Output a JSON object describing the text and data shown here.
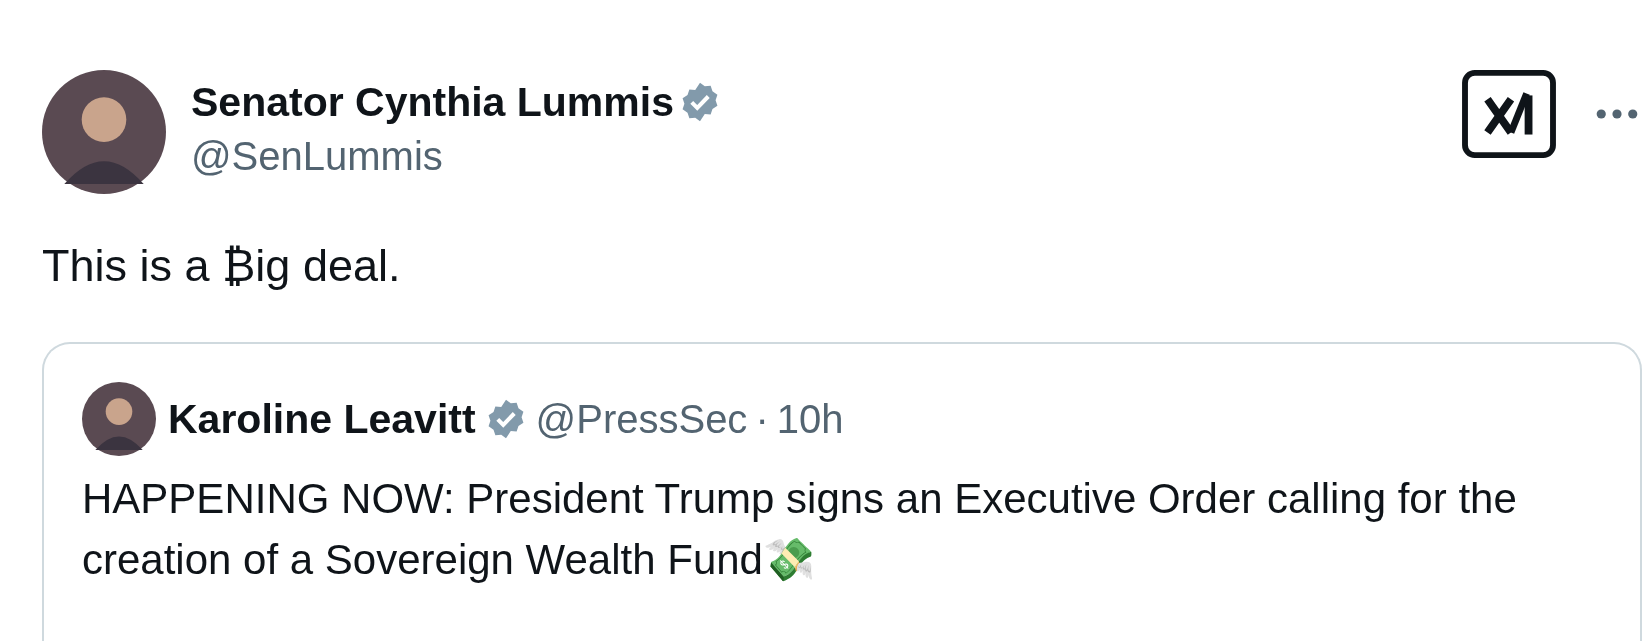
{
  "post": {
    "author": {
      "name": "Senator Cynthia Lummis",
      "verified": true,
      "handle": "@SenLummis"
    },
    "text": "This is a ₿ig deal.",
    "quoted_post": {
      "author": {
        "name": "Karoline Leavitt",
        "verified": true,
        "handle": "@PressSec"
      },
      "separator": "·",
      "time": "10h",
      "text": "HAPPENING NOW: President Trump signs an Executive Order calling for the creation of a Sovereign Wealth Fund💸"
    }
  }
}
